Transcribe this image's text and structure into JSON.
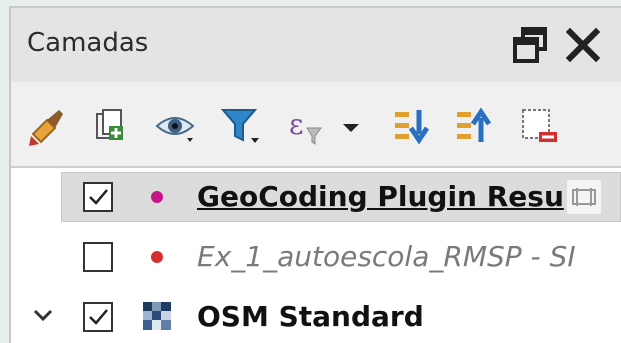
{
  "panel": {
    "title": "Camadas"
  },
  "toolbar": {
    "icons": [
      "style-brush-icon",
      "add-group-icon",
      "visibility-eye-icon",
      "filter-legend-icon",
      "expression-filter-icon",
      "expand-all-icon",
      "collapse-all-icon",
      "remove-layer-icon"
    ]
  },
  "layers": [
    {
      "label": "GeoCoding Plugin Resu",
      "checked": true,
      "dot_color": "#c71585",
      "selected": true,
      "style": "bold-underline"
    },
    {
      "label": "Ex_1_autoescola_RMSP - SI",
      "checked": false,
      "dot_color": "#d32f2f",
      "selected": false,
      "style": "italic"
    },
    {
      "label": "OSM Standard",
      "checked": true,
      "selected": false,
      "style": "bold",
      "expanded": true
    }
  ]
}
